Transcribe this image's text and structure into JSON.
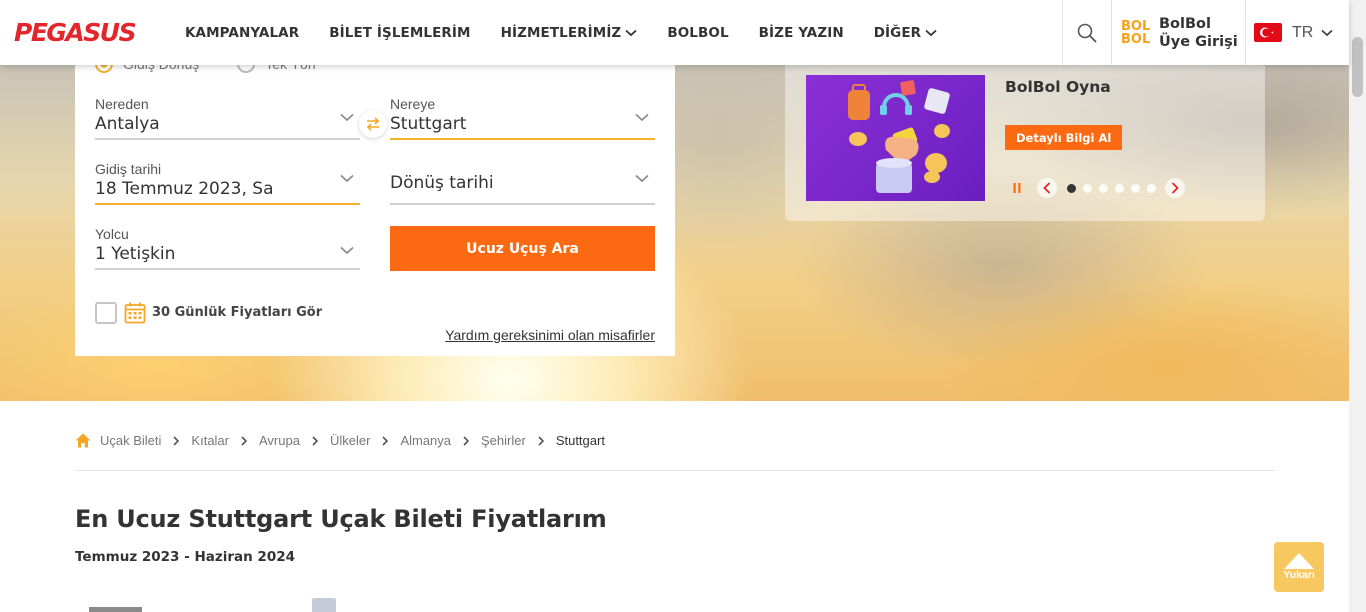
{
  "header": {
    "logo": "PEGASUS",
    "nav": [
      {
        "label": "KAMPANYALAR",
        "dropdown": false
      },
      {
        "label": "BİLET İŞLEMLERİM",
        "dropdown": false
      },
      {
        "label": "HİZMETLERİMİZ",
        "dropdown": true
      },
      {
        "label": "BOLBOL",
        "dropdown": false
      },
      {
        "label": "BİZE YAZIN",
        "dropdown": false
      },
      {
        "label": "DİĞER",
        "dropdown": true
      }
    ],
    "bolbol_logo_top": "BOL",
    "bolbol_logo_bottom": "BOL",
    "bolbol_line1": "BolBol",
    "bolbol_line2": "Üye Girişi",
    "lang": "TR"
  },
  "form": {
    "trip_types": [
      "Gidiş Dönüş",
      "Tek Yön"
    ],
    "from_label": "Nereden",
    "from_value": "Antalya",
    "to_label": "Nereye",
    "to_value": "Stuttgart",
    "depart_label": "Gidiş tarihi",
    "depart_value": "18 Temmuz 2023, Sa",
    "return_placeholder": "Dönüş tarihi",
    "pax_label": "Yolcu",
    "pax_value": "1 Yetişkin",
    "search_button": "Ucuz Uçuş Ara",
    "checkbox_label": "30 Günlük Fiyatları Gör",
    "help_link": "Yardım gereksinimi olan misafirler"
  },
  "promo": {
    "title": "BolBol Oyna",
    "button": "Detaylı Bilgi Al"
  },
  "breadcrumb": [
    "Uçak Bileti",
    "Kıtalar",
    "Avrupa",
    "Ülkeler",
    "Almanya",
    "Şehirler",
    "Stuttgart"
  ],
  "main": {
    "title": "En Ucuz Stuttgart Uçak Bileti Fiyatlarım",
    "subtitle": "Temmuz 2023 - Haziran 2024"
  },
  "back_to_top": "Yukarı",
  "colors": {
    "brand_red": "#e3262c",
    "orange": "#fb6a12",
    "accent_yellow": "#f6b12e"
  }
}
